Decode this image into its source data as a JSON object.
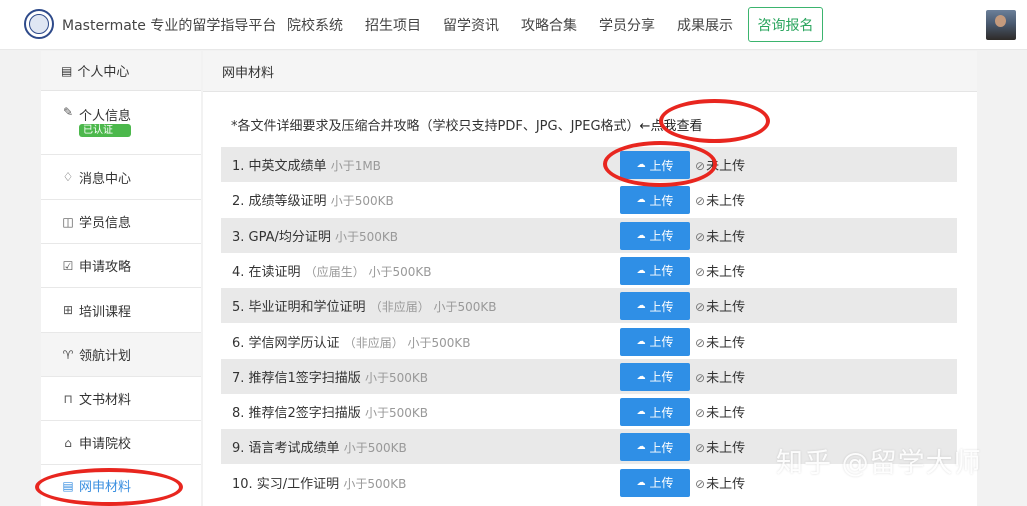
{
  "brand": "Mastermate 专业的留学指导平台",
  "nav": [
    "院校系统",
    "招生项目",
    "留学资讯",
    "攻略合集",
    "学员分享",
    "成果展示"
  ],
  "consult_button": "咨询报名",
  "sidebar": {
    "header": "个人中心",
    "items": [
      {
        "label": "个人信息",
        "badge": "已认证",
        "icon": "pen-icon"
      },
      {
        "label": "消息中心",
        "icon": "bell-icon"
      },
      {
        "label": "学员信息",
        "icon": "book-icon"
      },
      {
        "label": "申请攻略",
        "icon": "document-check-icon"
      },
      {
        "label": "培训课程",
        "icon": "grid-icon"
      },
      {
        "label": "领航计划",
        "icon": "trophy-icon"
      },
      {
        "label": "文书材料",
        "icon": "folder-icon"
      },
      {
        "label": "申请院校",
        "icon": "building-icon"
      },
      {
        "label": "网申材料",
        "icon": "document-icon"
      }
    ]
  },
  "panel": {
    "title": "网申材料",
    "instruction": "*各文件详细要求及压缩合并攻略（学校只支持PDF、JPG、JPEG格式）",
    "instruction_link": "←点我查看",
    "upload_label": "上传",
    "status_label": "未上传",
    "rows": [
      {
        "label": "1. 中英文成绩单",
        "hint": "小于1MB"
      },
      {
        "label": "2. 成绩等级证明",
        "hint": "小于500KB"
      },
      {
        "label": "3. GPA/均分证明",
        "hint": "小于500KB"
      },
      {
        "label": "4. 在读证明",
        "hint": "（应届生） 小于500KB"
      },
      {
        "label": "5. 毕业证明和学位证明",
        "hint": "（非应届） 小于500KB"
      },
      {
        "label": "6. 学信网学历认证",
        "hint": "（非应届） 小于500KB"
      },
      {
        "label": "7. 推荐信1签字扫描版",
        "hint": "小于500KB"
      },
      {
        "label": "8. 推荐信2签字扫描版",
        "hint": "小于500KB"
      },
      {
        "label": "9. 语言考试成绩单",
        "hint": "小于500KB"
      },
      {
        "label": "10. 实习/工作证明",
        "hint": "小于500KB"
      }
    ]
  },
  "watermark": "知乎 @留学大师",
  "colors": {
    "upload_button": "#2f8fe6",
    "active_sidebar": "#3a8fe0",
    "badge": "#4cb84c",
    "annotation": "#e8261f",
    "consult_border": "#3bb46e"
  }
}
